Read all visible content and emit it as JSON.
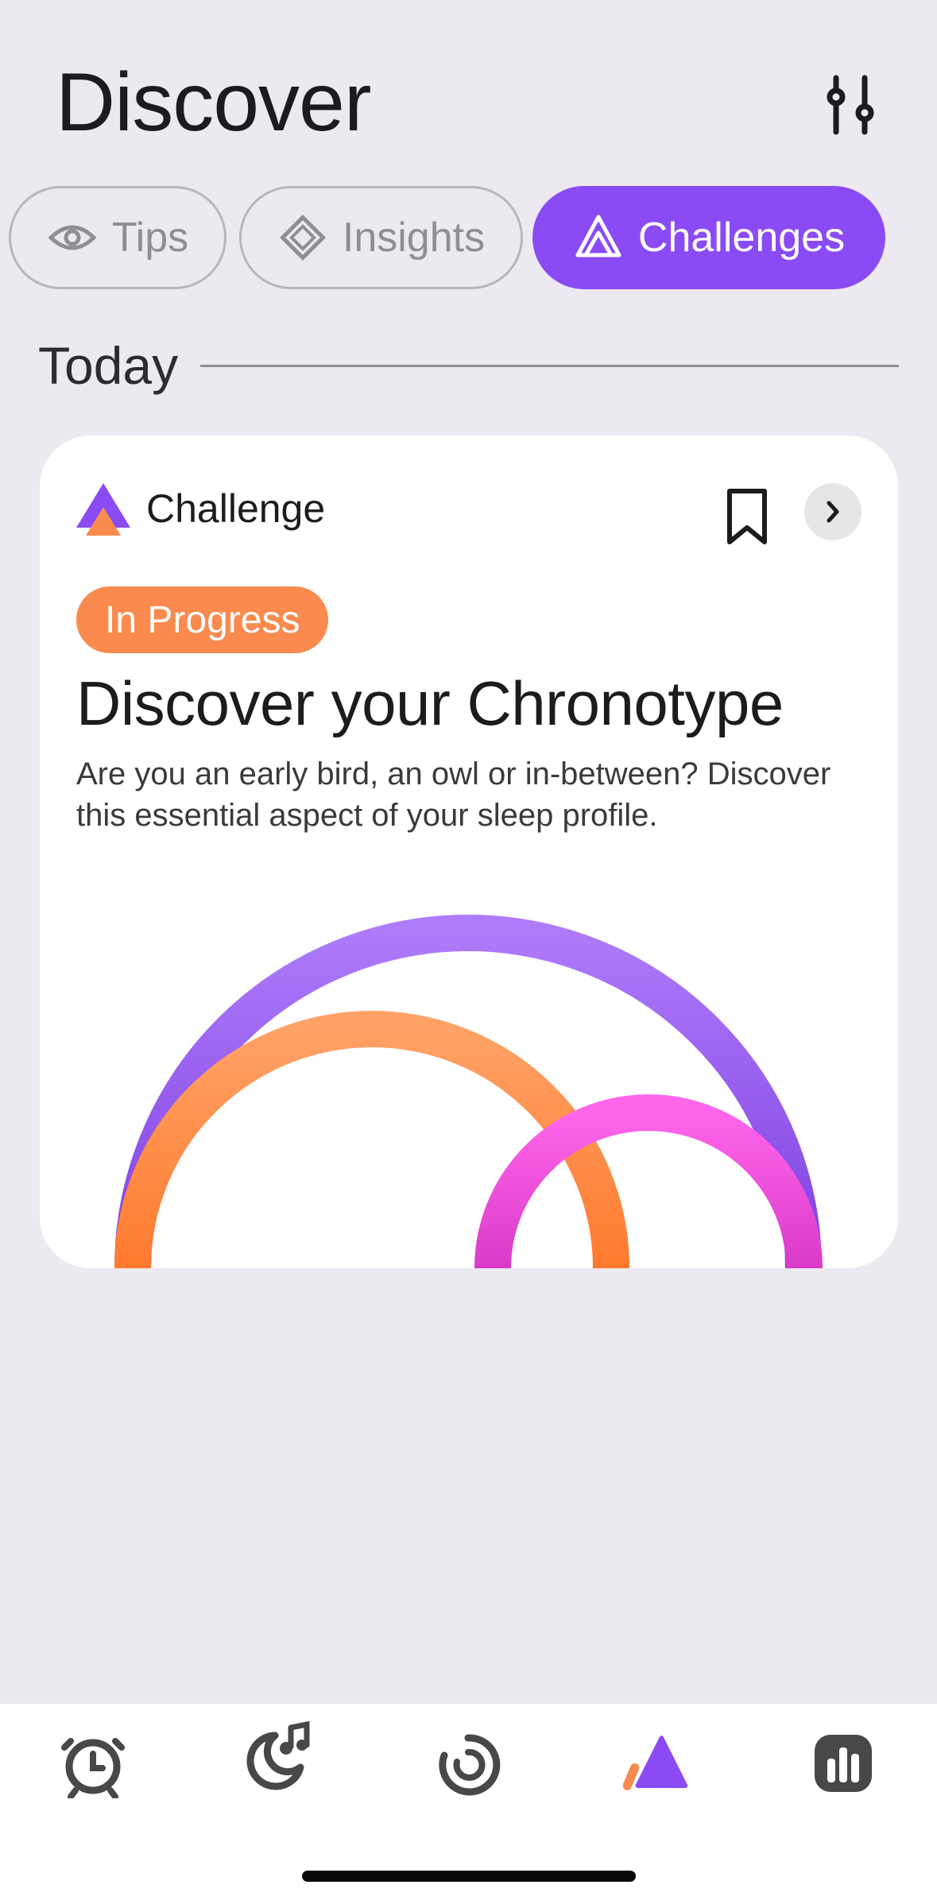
{
  "header": {
    "title": "Discover",
    "filter_icon": "sliders-icon"
  },
  "tabs": [
    {
      "label": "Tips",
      "icon": "eye-icon",
      "selected": false
    },
    {
      "label": "Insights",
      "icon": "diamond-icon",
      "selected": false
    },
    {
      "label": "Challenges",
      "icon": "challenge-icon",
      "selected": true
    }
  ],
  "section": {
    "label": "Today"
  },
  "card": {
    "kind_label": "Challenge",
    "badge": "In Progress",
    "title": "Discover your Chronotype",
    "description": "Are you an early bird, an owl or in-between? Discover this essential aspect of your sleep profile."
  },
  "colors": {
    "accent": "#8A4BF5",
    "orange": "#FA8A4D",
    "pink": "#EE4DD8",
    "background": "#ECE9F1"
  },
  "tabbar": [
    {
      "icon": "alarm-clock-icon",
      "selected": false
    },
    {
      "icon": "moon-music-icon",
      "selected": false
    },
    {
      "icon": "spiral-icon",
      "selected": false
    },
    {
      "icon": "discover-icon",
      "selected": true
    },
    {
      "icon": "stats-icon",
      "selected": false
    }
  ]
}
